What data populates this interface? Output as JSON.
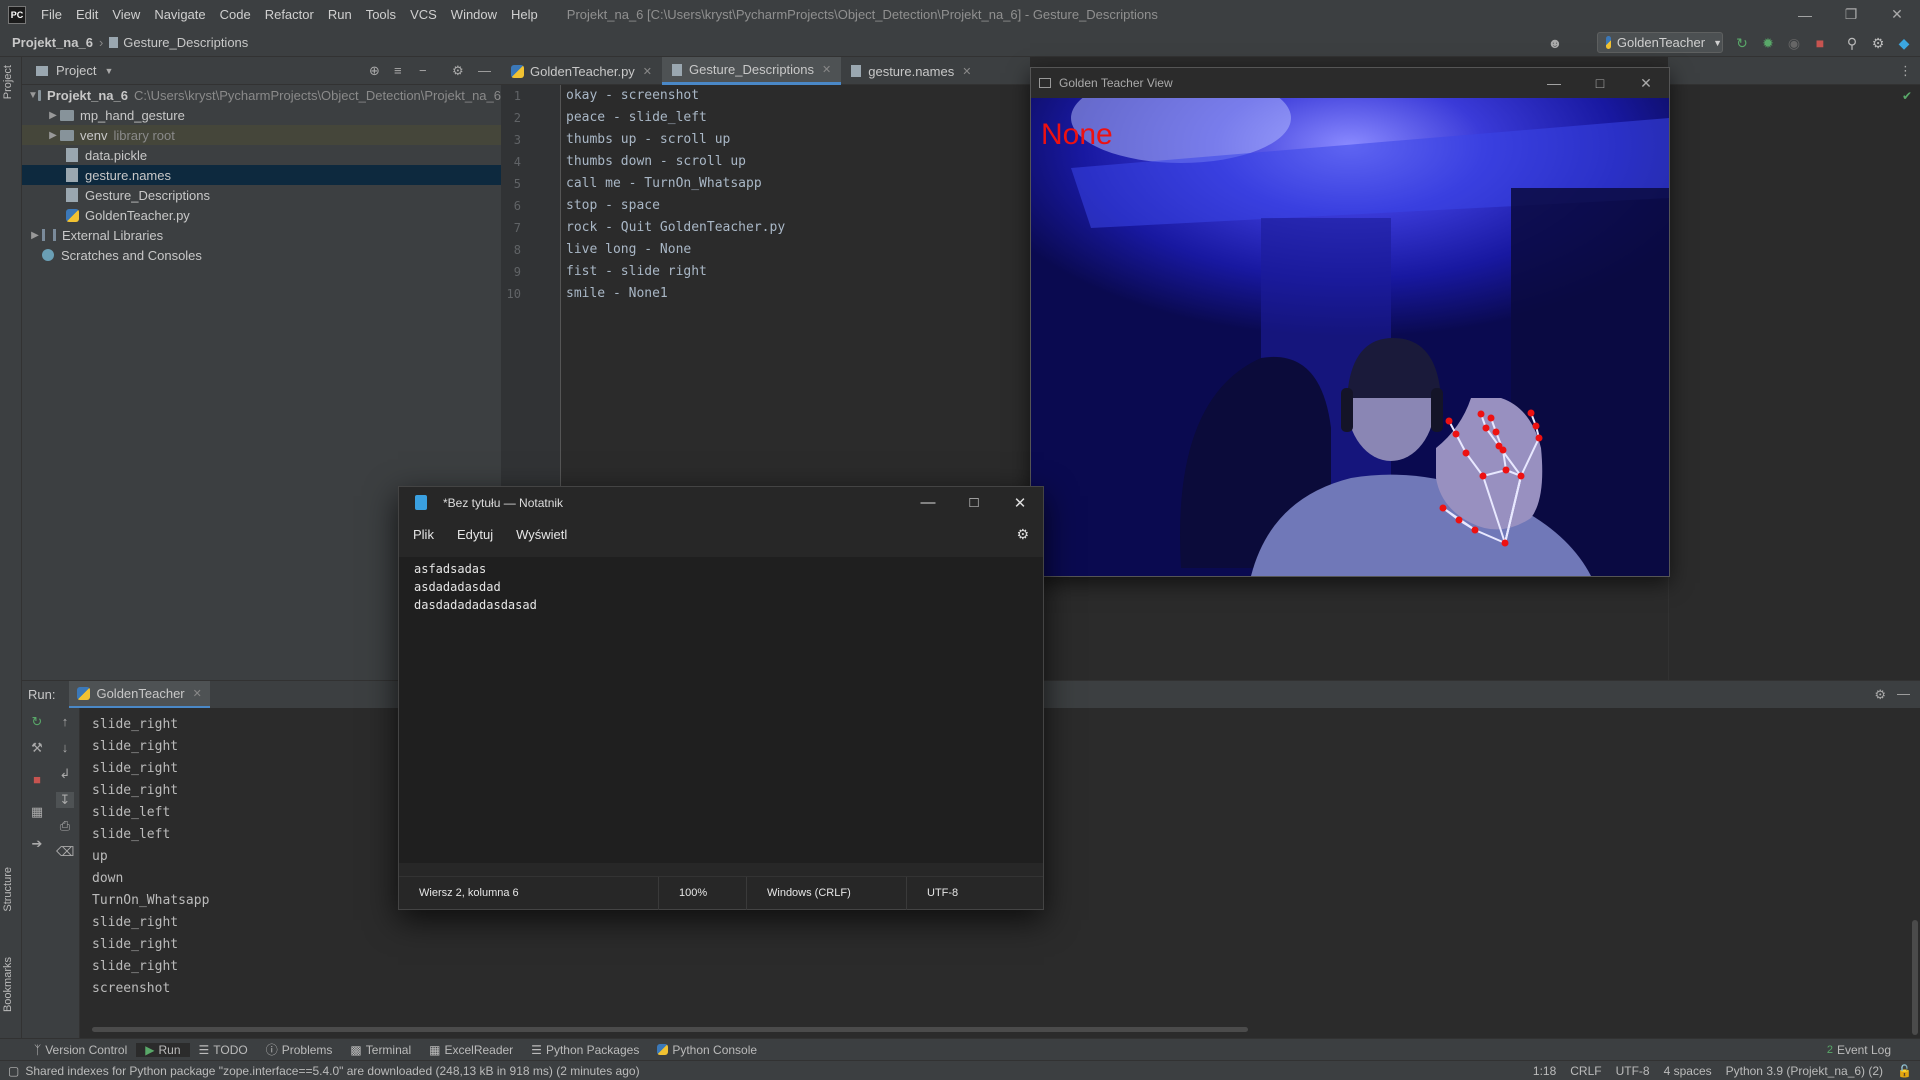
{
  "app": {
    "logo": "PC",
    "menu": [
      "File",
      "Edit",
      "View",
      "Navigate",
      "Code",
      "Refactor",
      "Run",
      "Tools",
      "VCS",
      "Window",
      "Help"
    ],
    "window_title": "Projekt_na_6 [C:\\Users\\kryst\\PycharmProjects\\Object_Detection\\Projekt_na_6] - Gesture_Descriptions",
    "window_controls": [
      "minimize-icon",
      "restore-icon",
      "close-icon"
    ]
  },
  "navbar": {
    "project": "Projekt_na_6",
    "file": "Gesture_Descriptions",
    "run_config": "GoldenTeacher"
  },
  "project_panel": {
    "title": "Project",
    "root": {
      "name": "Projekt_na_6",
      "path": "C:\\Users\\kryst\\PycharmProjects\\Object_Detection\\Projekt_na_6"
    },
    "items": [
      {
        "name": "mp_hand_gesture",
        "kind": "folder"
      },
      {
        "name": "venv",
        "kind": "folder",
        "note": "library root"
      },
      {
        "name": "data.pickle",
        "kind": "file"
      },
      {
        "name": "gesture.names",
        "kind": "file"
      },
      {
        "name": "Gesture_Descriptions",
        "kind": "file"
      },
      {
        "name": "GoldenTeacher.py",
        "kind": "python"
      }
    ],
    "external": "External Libraries",
    "scratches": "Scratches and Consoles"
  },
  "editor": {
    "tabs": [
      {
        "label": "GoldenTeacher.py",
        "active": false
      },
      {
        "label": "Gesture_Descriptions",
        "active": true
      },
      {
        "label": "gesture.names",
        "active": false
      }
    ],
    "lines": [
      "okay - screenshot",
      "peace - slide_left",
      "thumbs up - scroll up",
      "thumbs down - scroll up",
      "call me - TurnOn_Whatsapp",
      "stop - space",
      "rock - Quit GoldenTeacher.py",
      "live long - None",
      "fist - slide right",
      "smile - None1"
    ]
  },
  "golden_teacher": {
    "title": "Golden Teacher View",
    "gesture_label": "None"
  },
  "notepad": {
    "title": "*Bez tytułu — Notatnik",
    "menu": [
      "Plik",
      "Edytuj",
      "Wyświetl"
    ],
    "lines": [
      "asfadsadas",
      "asdadadasdad",
      "dasdadadadasdasad"
    ],
    "status": {
      "position": "Wiersz 2, kolumna 6",
      "zoom": "100%",
      "line_ending": "Windows (CRLF)",
      "encoding": "UTF-8"
    }
  },
  "run": {
    "label": "Run:",
    "tab": "GoldenTeacher",
    "output": [
      "slide_right",
      "slide_right",
      "slide_right",
      "slide_right",
      "slide_left",
      "slide_left",
      "up",
      "down",
      "TurnOn_Whatsapp",
      "slide_right",
      "slide_right",
      "slide_right",
      "screenshot"
    ]
  },
  "tool_windows": [
    "Version Control",
    "Run",
    "TODO",
    "Problems",
    "Terminal",
    "ExcelReader",
    "Python Packages",
    "Python Console"
  ],
  "event_log": "Event Log",
  "event_log_count": "2",
  "side_tabs": {
    "project": "Project",
    "structure": "Structure",
    "bookmarks": "Bookmarks"
  },
  "status": {
    "message": "Shared indexes for Python package \"zope.interface==5.4.0\" are downloaded (248,13 kB in 918 ms) (2 minutes ago)",
    "position": "1:18",
    "line_ending": "CRLF",
    "encoding": "UTF-8",
    "indent": "4 spaces",
    "interpreter": "Python 3.9 (Projekt_na_6) (2)"
  },
  "colors": {
    "accent": "#4a88c7",
    "editor_bg": "#2b2b2b",
    "panel_bg": "#3c3f41",
    "gesture_label": "#ee1111"
  }
}
